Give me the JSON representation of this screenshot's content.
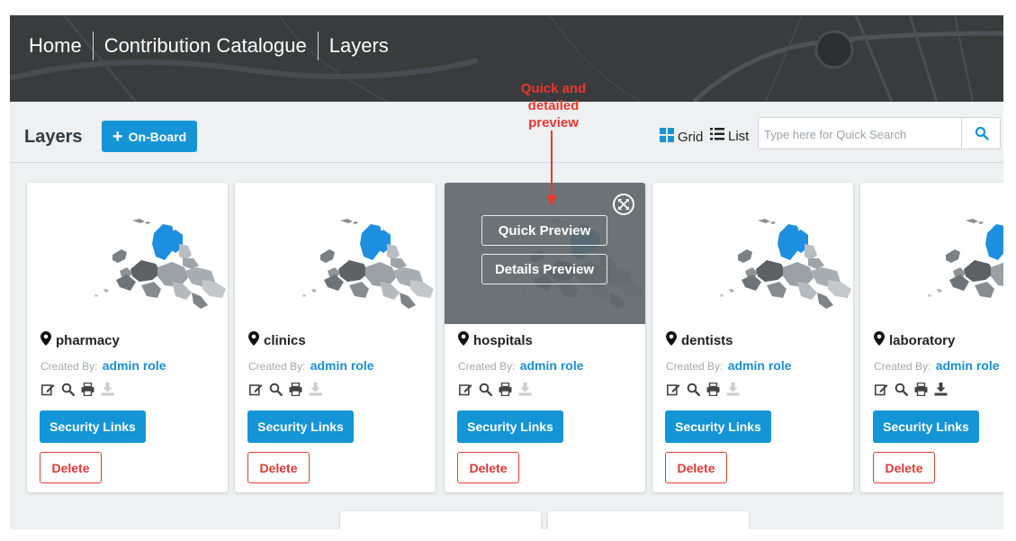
{
  "header": {
    "breadcrumbs": [
      "Home",
      "Contribution Catalogue",
      "Layers"
    ]
  },
  "toolbar": {
    "title": "Layers",
    "onboard_label": "On-Board",
    "grid_label": "Grid",
    "list_label": "List",
    "search_placeholder": "Type here for Quick Search",
    "search_value": ""
  },
  "annotation": {
    "lines": [
      "Quick and",
      "detailed",
      "preview"
    ]
  },
  "overlay": {
    "quick_preview_label": "Quick Preview",
    "details_preview_label": "Details Preview"
  },
  "cards": [
    {
      "name": "pharmacy",
      "created_by_label": "Created By:",
      "owner": "admin role",
      "security_label": "Security Links",
      "delete_label": "Delete",
      "download_enabled": false,
      "hovered": false
    },
    {
      "name": "clinics",
      "created_by_label": "Created By:",
      "owner": "admin role",
      "security_label": "Security Links",
      "delete_label": "Delete",
      "download_enabled": false,
      "hovered": false
    },
    {
      "name": "hospitals",
      "created_by_label": "Created By:",
      "owner": "admin role",
      "security_label": "Security Links",
      "delete_label": "Delete",
      "download_enabled": false,
      "hovered": true
    },
    {
      "name": "dentists",
      "created_by_label": "Created By:",
      "owner": "admin role",
      "security_label": "Security Links",
      "delete_label": "Delete",
      "download_enabled": false,
      "hovered": false
    },
    {
      "name": "laboratory",
      "created_by_label": "Created By:",
      "owner": "admin role",
      "security_label": "Security Links",
      "delete_label": "Delete",
      "download_enabled": true,
      "hovered": false
    }
  ],
  "icons": {
    "grid": "grid-icon",
    "list": "list-icon",
    "search": "search-icon",
    "plus": "plus-icon",
    "marker": "map-marker-icon",
    "edit": "edit-icon",
    "view": "magnifier-icon",
    "print": "print-icon",
    "download": "download-icon",
    "expand": "expand-icon"
  },
  "colors": {
    "primary": "#1594d6",
    "danger": "#dc3a33",
    "annotation": "#e8372f",
    "overlay": "#5f676b",
    "banner": "#3c3c3e",
    "owner_link": "#1a8fcf"
  }
}
